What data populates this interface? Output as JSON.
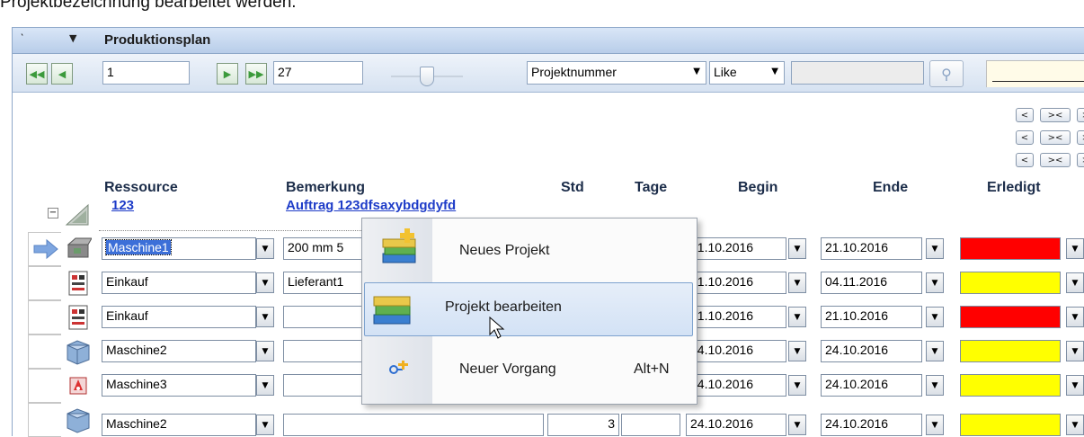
{
  "caption": "Projektbezeichnung bearbeitet werden.",
  "panel": {
    "title": "Produktionsplan"
  },
  "navigator": {
    "current_record": "1",
    "total_records": "27",
    "filter_field": "Projektnummer",
    "filter_operator": "Like",
    "filter_value": ""
  },
  "columns": {
    "ressource": "Ressource",
    "bemerkung": "Bemerkung",
    "std": "Std",
    "tage": "Tage",
    "begin": "Begin",
    "ende": "Ende",
    "erledigt": "Erledigt"
  },
  "group": {
    "id": "123",
    "remark": "Auftrag 123dfsaxybdgdyfd"
  },
  "rows": [
    {
      "ressource": "Maschine1",
      "bemerkung": "200 mm 5",
      "std": "",
      "tage": "",
      "begin": "21.10.2016",
      "ende": "21.10.2016",
      "erledigt_color": "#ff0000"
    },
    {
      "ressource": "Einkauf",
      "bemerkung": "Lieferant1",
      "std": "",
      "tage": "",
      "begin": "21.10.2016",
      "ende": "04.11.2016",
      "erledigt_color": "#ffff00"
    },
    {
      "ressource": "Einkauf",
      "bemerkung": "",
      "std": "",
      "tage": "",
      "begin": "21.10.2016",
      "ende": "21.10.2016",
      "erledigt_color": "#ff0000"
    },
    {
      "ressource": "Maschine2",
      "bemerkung": "",
      "std": "",
      "tage": "",
      "begin": "24.10.2016",
      "ende": "24.10.2016",
      "erledigt_color": "#ffff00"
    },
    {
      "ressource": "Maschine3",
      "bemerkung": "",
      "std": "",
      "tage": "",
      "begin": "24.10.2016",
      "ende": "24.10.2016",
      "erledigt_color": "#ffff00"
    },
    {
      "ressource": "Maschine2",
      "bemerkung": "",
      "std": "3",
      "tage": "",
      "begin": "24.10.2016",
      "ende": "24.10.2016",
      "erledigt_color": "#ffff00"
    }
  ],
  "context_menu": {
    "items": [
      {
        "label": "Neues Projekt",
        "shortcut": "",
        "icon": "new-project-icon"
      },
      {
        "label": "Projekt bearbeiten",
        "shortcut": "",
        "icon": "edit-project-icon"
      },
      {
        "label": "Neuer Vorgang",
        "shortcut": "Alt+N",
        "icon": "new-task-icon"
      }
    ]
  },
  "mini_buttons": [
    "<",
    "><",
    ">"
  ]
}
